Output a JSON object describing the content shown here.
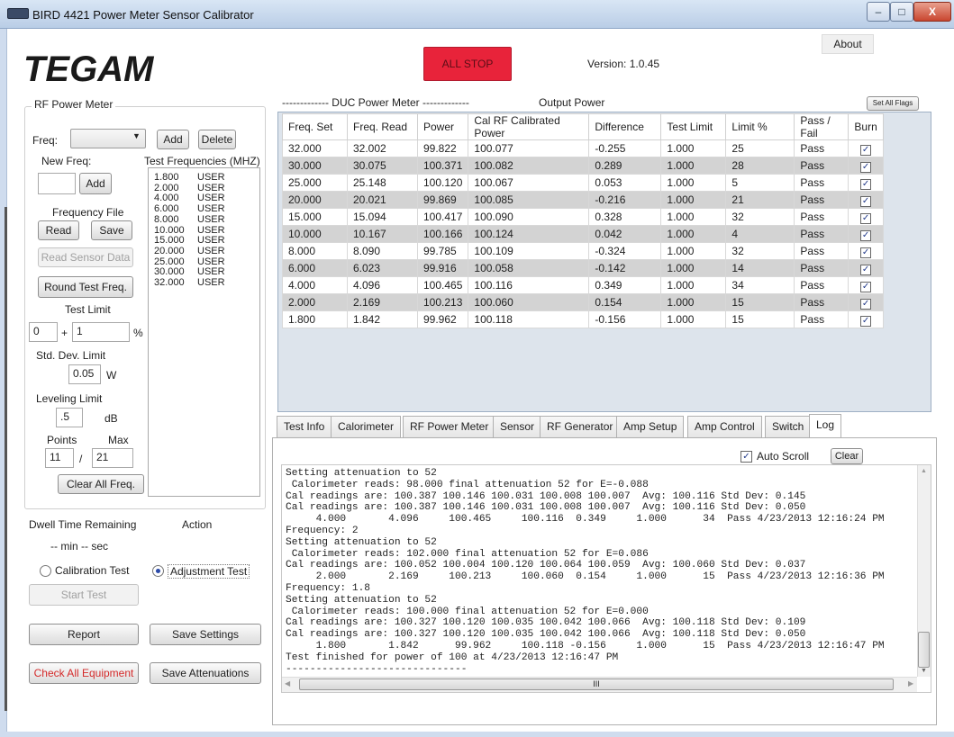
{
  "window": {
    "title": "BIRD 4421 Power Meter Sensor Calibrator",
    "minimize": "–",
    "maximize": "□",
    "close": "X"
  },
  "brand": {
    "logo": "TEGAM",
    "logo_color": "#1a1a1a"
  },
  "header": {
    "all_stop": "ALL STOP",
    "all_stop_color": "#e8233a",
    "version": "Version:  1.0.45",
    "about": "About"
  },
  "rf_power_meter": {
    "group_title": "RF Power Meter",
    "freq_label": "Freq:",
    "freq_value": "",
    "add": "Add",
    "delete": "Delete",
    "new_freq_label": "New Freq:",
    "new_freq_value": "",
    "new_freq_add": "Add",
    "test_freq_label": "Test Frequencies (MHZ)",
    "frequency_file_label": "Frequency File",
    "read": "Read",
    "save": "Save",
    "read_sensor_data": "Read Sensor Data",
    "round_test_freq": "Round Test Freq.",
    "test_limit_label": "Test Limit",
    "test_limit_low": "0",
    "test_limit_plus": "+",
    "test_limit_high": "1",
    "test_limit_unit": "%",
    "std_dev_label": "Std. Dev. Limit",
    "std_dev_value": "0.05",
    "std_dev_unit": "W",
    "leveling_label": "Leveling Limit",
    "leveling_value": ".5",
    "leveling_unit": "dB",
    "points_label": "Points",
    "max_label": "Max",
    "points_value": "11",
    "points_sep": "/",
    "max_value": "21",
    "clear_all_freq": "Clear All Freq.",
    "frequencies": [
      {
        "freq": "1.800",
        "src": "USER"
      },
      {
        "freq": "2.000",
        "src": "USER"
      },
      {
        "freq": "4.000",
        "src": "USER"
      },
      {
        "freq": "6.000",
        "src": "USER"
      },
      {
        "freq": "8.000",
        "src": "USER"
      },
      {
        "freq": "10.000",
        "src": "USER"
      },
      {
        "freq": "15.000",
        "src": "USER"
      },
      {
        "freq": "20.000",
        "src": "USER"
      },
      {
        "freq": "25.000",
        "src": "USER"
      },
      {
        "freq": "30.000",
        "src": "USER"
      },
      {
        "freq": "32.000",
        "src": "USER"
      }
    ]
  },
  "controls": {
    "dwell_label": "Dwell Time Remaining",
    "action_label": "Action",
    "dwell_value": "--  min  -- sec",
    "calibration_test": "Calibration Test",
    "adjustment_test": "Adjustment Test",
    "selected_test": "Adjustment Test",
    "start_test": "Start Test",
    "report": "Report",
    "save_settings": "Save Settings",
    "check_all_equipment": "Check All Equipment",
    "check_color": "#d42a2a",
    "save_attenuations": "Save Attenuations"
  },
  "table": {
    "duc_title": "------------- DUC Power Meter -------------",
    "output_title": "Output Power",
    "set_all_flags": "Set All Flags",
    "columns": [
      "Freq. Set",
      "Freq. Read",
      "Power",
      "Cal RF Calibrated Power",
      "Difference",
      "Test Limit",
      "Limit %",
      "Pass / Fail",
      "Burn"
    ],
    "rows": [
      [
        "32.000",
        "32.002",
        "99.822",
        "100.077",
        "-0.255",
        "1.000",
        "25",
        "Pass",
        true
      ],
      [
        "30.000",
        "30.075",
        "100.371",
        "100.082",
        "0.289",
        "1.000",
        "28",
        "Pass",
        true
      ],
      [
        "25.000",
        "25.148",
        "100.120",
        "100.067",
        "0.053",
        "1.000",
        "5",
        "Pass",
        true
      ],
      [
        "20.000",
        "20.021",
        "99.869",
        "100.085",
        "-0.216",
        "1.000",
        "21",
        "Pass",
        true
      ],
      [
        "15.000",
        "15.094",
        "100.417",
        "100.090",
        "0.328",
        "1.000",
        "32",
        "Pass",
        true
      ],
      [
        "10.000",
        "10.167",
        "100.166",
        "100.124",
        "0.042",
        "1.000",
        "4",
        "Pass",
        true
      ],
      [
        "8.000",
        "8.090",
        "99.785",
        "100.109",
        "-0.324",
        "1.000",
        "32",
        "Pass",
        true
      ],
      [
        "6.000",
        "6.023",
        "99.916",
        "100.058",
        "-0.142",
        "1.000",
        "14",
        "Pass",
        true
      ],
      [
        "4.000",
        "4.096",
        "100.465",
        "100.116",
        "0.349",
        "1.000",
        "34",
        "Pass",
        true
      ],
      [
        "2.000",
        "2.169",
        "100.213",
        "100.060",
        "0.154",
        "1.000",
        "15",
        "Pass",
        true
      ],
      [
        "1.800",
        "1.842",
        "99.962",
        "100.118",
        "-0.156",
        "1.000",
        "15",
        "Pass",
        true
      ]
    ]
  },
  "tabs": [
    "Test Info",
    "Calorimeter",
    "RF Power Meter",
    "Sensor",
    "RF Generator",
    "Amp Setup",
    "Amp Control",
    "Switch",
    "Log"
  ],
  "active_tab": "Log",
  "log": {
    "auto_scroll_label": "Auto Scroll",
    "auto_scroll_checked": true,
    "clear": "Clear",
    "hscroll_grip": "III",
    "lines": [
      "Setting attenuation to 52",
      " Calorimeter reads: 98.000 final attenuation 52 for E=-0.088",
      "Cal readings are: 100.387 100.146 100.031 100.008 100.007  Avg: 100.116 Std Dev: 0.145",
      "Cal readings are: 100.387 100.146 100.031 100.008 100.007  Avg: 100.116 Std Dev: 0.050",
      "     4.000       4.096     100.465     100.116  0.349     1.000      34  Pass 4/23/2013 12:16:24 PM",
      "Frequency: 2",
      "Setting attenuation to 52",
      " Calorimeter reads: 102.000 final attenuation 52 for E=0.086",
      "Cal readings are: 100.052 100.004 100.120 100.064 100.059  Avg: 100.060 Std Dev: 0.037",
      "     2.000       2.169     100.213     100.060  0.154     1.000      15  Pass 4/23/2013 12:16:36 PM",
      "Frequency: 1.8",
      "Setting attenuation to 52",
      " Calorimeter reads: 100.000 final attenuation 52 for E=0.000",
      "Cal readings are: 100.327 100.120 100.035 100.042 100.066  Avg: 100.118 Std Dev: 0.109",
      "Cal readings are: 100.327 100.120 100.035 100.042 100.066  Avg: 100.118 Std Dev: 0.050",
      "     1.800       1.842      99.962     100.118 -0.156     1.000      15  Pass 4/23/2013 12:16:47 PM",
      "Test finished for power of 100 at 4/23/2013 12:16:47 PM",
      "------------------------------"
    ]
  }
}
